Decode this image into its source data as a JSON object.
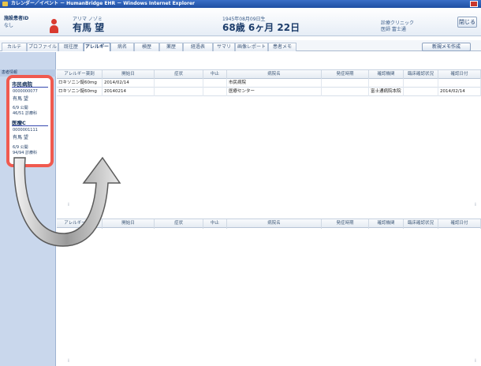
{
  "window": {
    "title": "カレンダー／イベント － HumanBridge EHR － Windows Internet Explorer"
  },
  "patient": {
    "label_top": "施設患者ID",
    "label_bottom": "なし",
    "kana": "アリマ ノゾミ",
    "name": "有馬 望",
    "birth_label": "1945年08月09日生",
    "age": "68歳 6ヶ月 22日",
    "clinic_top": "診療クリニック",
    "clinic_bottom": "医師 富士通",
    "close_label": "閉じる"
  },
  "tabs": [
    {
      "label": "カルテ",
      "active": false
    },
    {
      "label": "プロファイル",
      "active": false
    },
    {
      "label": "既往歴",
      "active": false
    },
    {
      "label": "アレルギー",
      "active": true
    },
    {
      "label": "病名",
      "active": false
    },
    {
      "label": "検歴",
      "active": false
    },
    {
      "label": "薬歴",
      "active": false
    },
    {
      "label": "経過表",
      "active": false
    },
    {
      "label": "サマリ",
      "active": false
    },
    {
      "label": "画像レポート",
      "active": false
    },
    {
      "label": "患者メモ",
      "active": false
    }
  ],
  "new_memo_label": "新規メモ作成",
  "sidebar": {
    "header": "患者情報"
  },
  "panel": {
    "hospital1": "市民病院",
    "id1": "0000000077",
    "name1": "有馬 望",
    "count1_a": "6/9 公開",
    "count1_b": "46/51 診療科",
    "hospital2": "医療C",
    "id2": "0000001111",
    "name2": "有馬 望",
    "count2_a": "6/9 公開",
    "count2_b": "94/94 診療科"
  },
  "top_table": {
    "headers": [
      "アレルギー薬剤",
      "開始日",
      "症状",
      "中止",
      "病院名",
      "発症時期",
      "確認機関",
      "臨床確認状況",
      "確認日付"
    ],
    "rows": [
      [
        "ロキソニン錠60mg",
        "2014/02/14",
        "",
        "",
        "市民病院",
        "",
        "",
        "",
        ""
      ],
      [
        "ロキソニン錠60mg",
        "20140214",
        "",
        "",
        "医療センター",
        "",
        "富士通病院本院",
        "",
        "2014/02/14"
      ]
    ]
  },
  "bottom_table": {
    "headers": [
      "アレルギー薬剤",
      "開始日",
      "症状",
      "中止",
      "病院名",
      "発症時期",
      "確認機関",
      "臨床確認状況",
      "確認日付"
    ]
  }
}
